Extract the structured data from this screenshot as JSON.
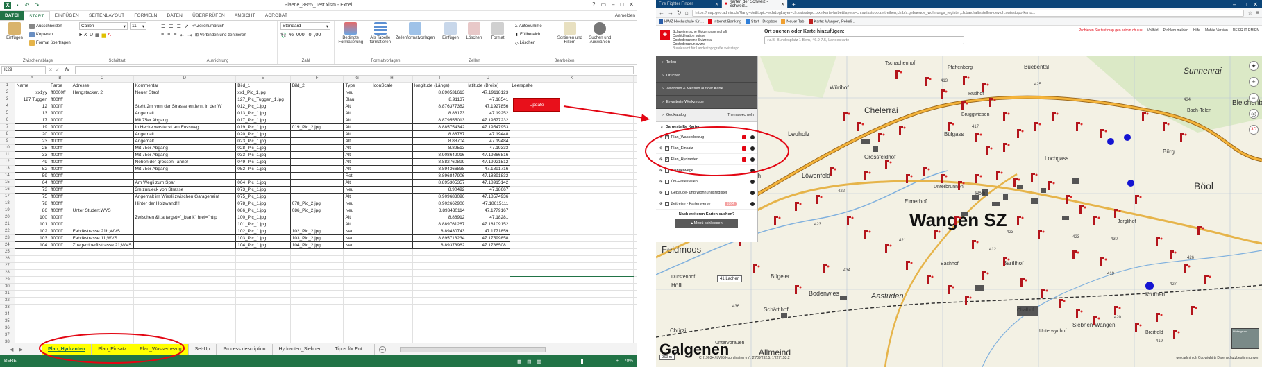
{
  "excel": {
    "title": "Plaene_8855_Test.xlsm - Excel",
    "ribbon_tabs": [
      "DATEI",
      "START",
      "EINFÜGEN",
      "SEITENLAYOUT",
      "FORMELN",
      "DATEN",
      "ÜBERPRÜFEN",
      "ANSICHT",
      "ACROBAT"
    ],
    "signin": "Anmelden",
    "clipboard": {
      "paste": "Einfügen",
      "cut": "Ausschneiden",
      "copy": "Kopieren",
      "format_painter": "Format übertragen",
      "label": "Zwischenablage"
    },
    "font": {
      "name": "Calibri",
      "size": "11",
      "label": "Schriftart"
    },
    "alignment": {
      "wrap": "Zeilenumbruch",
      "merge": "Verbinden und zentrieren",
      "label": "Ausrichtung"
    },
    "number": {
      "format": "Standard",
      "label": "Zahl"
    },
    "styles": {
      "conditional": "Bedingte Formatierung",
      "as_table": "Als Tabelle formatieren",
      "cell_styles": "Zellenformatvorlagen",
      "label": "Formatvorlagen"
    },
    "cells": {
      "insert": "Einfügen",
      "delete": "Löschen",
      "format": "Format",
      "label": "Zellen"
    },
    "editing": {
      "autosum": "AutoSumme",
      "fill": "Füllbereich",
      "clear": "Löschen",
      "sort": "Sortieren und Filtern",
      "find": "Suchen und Auswählen",
      "label": "Bearbeiten"
    },
    "namebox": "K29",
    "columns": [
      "A",
      "B",
      "C",
      "D",
      "E",
      "F",
      "G",
      "H",
      "I",
      "J",
      "K"
    ],
    "headers": [
      "Name",
      "Farbe",
      "Adresse",
      "Kommentar",
      "Bild_1",
      "Bild_2",
      "Type",
      "IconScale",
      "longitude (Länge)",
      "latitude (Breite)",
      "Leerspalte"
    ],
    "rows": [
      [
        "xx1yy",
        "ff0000ff",
        "Hengstacker. 2",
        "Neuer Stao!",
        "xx1_Pic_1.jpg",
        "",
        "Neu",
        "",
        "8.890531613",
        "47.19118123",
        ""
      ],
      [
        "127 Tuggen",
        "ff00ffff",
        "",
        "",
        "127_Pic_Tuggen_1.jpg",
        "",
        "Blau",
        "",
        "8.91137",
        "47.18541",
        ""
      ],
      [
        "12",
        "ff00ffff",
        "",
        "Steht 2m vom der Strasse entfernt in der W",
        "012_Pic_1.jpg",
        "",
        "Alt",
        "",
        "8.876377382",
        "47.1927856",
        ""
      ],
      [
        "13",
        "ff00ffff",
        "",
        "Angemalt",
        "013_Pic_1.jpg",
        "",
        "Alt",
        "",
        "8.88173",
        "47.19252",
        ""
      ],
      [
        "17",
        "ff00ffff",
        "",
        "Mit 75er Abgang",
        "017_Pic_1.jpg",
        "",
        "Alt",
        "",
        "8.879555013",
        "47.19577232",
        ""
      ],
      [
        "19",
        "ff00ffff",
        "",
        "In Hecke versteckt am Fussweg",
        "019_Pic_1.jpg",
        "019_Pic_2.jpg",
        "Alt",
        "",
        "8.885754342",
        "47.19547953",
        ""
      ],
      [
        "20",
        "ff00ffff",
        "",
        "Angemalt",
        "020_Pic_1.jpg",
        "",
        "Alt",
        "",
        "8.88787",
        "47.19448",
        ""
      ],
      [
        "23",
        "ff00ffff",
        "",
        "Angemalt",
        "023_Pic_1.jpg",
        "",
        "Alt",
        "",
        "8.88704",
        "47.19484",
        ""
      ],
      [
        "28",
        "ff00ffff",
        "",
        "Mit 75er Abgang",
        "028_Pic_1.jpg",
        "",
        "Alt",
        "",
        "8.89513",
        "47.19333",
        ""
      ],
      [
        "33",
        "ff00ffff",
        "",
        "Mit 75er Abgang",
        "033_Pic_1.jpg",
        "",
        "Alt",
        "",
        "8.908642016",
        "47.19866816",
        ""
      ],
      [
        "49",
        "ff00ffff",
        "",
        "Neben der grossen Tanne!",
        "049_Pic_1.jpg",
        "",
        "Alt",
        "",
        "8.882760899",
        "47.19921512",
        ""
      ],
      [
        "52",
        "ff00ffff",
        "",
        "Mit 75er Abgang",
        "052_Pic_1.jpg",
        "",
        "Alt",
        "",
        "8.894366838",
        "47.1891716",
        ""
      ],
      [
        "59",
        "ff00ffff",
        "",
        "",
        "",
        "",
        "Rot",
        "",
        "8.896847906",
        "47.18391832",
        ""
      ],
      [
        "64",
        "ff00ffff",
        "",
        "Am Wegli zum Spar",
        "064_Pic_1.jpg",
        "",
        "Alt",
        "",
        "8.895305357",
        "47.18915142",
        ""
      ],
      [
        "73",
        "ff00ffff",
        "",
        "3m zurueck von Strasse",
        "073_Pic_1.jpg",
        "",
        "Neu",
        "",
        "8.90492",
        "47.18667",
        ""
      ],
      [
        "75",
        "ff00ffff",
        "",
        "Angemalt im Wiesli zwischen Garageneinf",
        "075_Pic_1.jpg",
        "",
        "Alt",
        "",
        "8.909683096",
        "47.18574936",
        ""
      ],
      [
        "78",
        "ff00ffff",
        "",
        "Hinter der Holzwand!!!",
        "078_Pic_1.jpg",
        "078_Pic_2.jpg",
        "Neu",
        "",
        "8.902662906",
        "47.18615111",
        ""
      ],
      [
        "86",
        "ff00ffff",
        "Unter Studen;WVS",
        "",
        "086_Pic_1.jpg",
        "086_Pic_2.jpg",
        "Neu",
        "",
        "8.893430114",
        "47.1779167",
        ""
      ],
      [
        "100",
        "ff00ffff",
        "",
        "Zwischen &lt;a target=\"_blank\" href=\"http",
        "100_Pic_1.jpg",
        "",
        "Alt",
        "",
        "8.88912",
        "47.18281",
        ""
      ],
      [
        "101",
        "ff00ffff",
        "",
        "",
        "101_Pic_1.jpg",
        "",
        "Alt",
        "",
        "8.889761267",
        "47.18109152",
        ""
      ],
      [
        "102",
        "ff00ffff",
        "Fabrikstrasse 21h;WVS",
        "",
        "102_Pic_1.jpg",
        "102_Pic_2.jpg",
        "Neu",
        "",
        "8.89430743",
        "47.1771859",
        ""
      ],
      [
        "103",
        "ff00ffff",
        "Fabrikstrasse 11;WVS",
        "",
        "103_Pic_1.jpg",
        "103_Pic_2.jpg",
        "Neu",
        "",
        "8.895713234",
        "47.17599858",
        ""
      ],
      [
        "104",
        "ff00ffff",
        "Zuegerdoerflistrasse 21;WVS",
        "",
        "104_Pic_1.jpg",
        "104_Pic_2.jpg",
        "Neu",
        "",
        "8.89373962",
        "47.17865081",
        ""
      ]
    ],
    "update_button": "Update",
    "sheet_tabs": [
      "Plan_Hydranten",
      "Plan_Einsatz",
      "Plan_Wasserbezug",
      "Set-Up",
      "Process description",
      "Hydranten_Siebnen",
      "Tipps für Ent ..."
    ],
    "status_left": "BEREIT",
    "zoom": "70%"
  },
  "browser": {
    "tabs": [
      "Fire Fighter Finder",
      "Karten der Schweiz - Schweiz..."
    ],
    "url": "https://map.geo.admin.ch/?lang=de&topic=ech&bgLayer=ch.swisstopo.pixelkarte-farbe&layers=ch.swisstopo.zeitreihen,ch.bfs.gebaeude_wohnungs_register,ch.bav.haltestellen-oev,ch.swisstopo-karto...",
    "bookmarks": [
      "HWZ Hochschule für ...",
      "Internet Banking",
      "Start - Dropbox",
      "Neuer Tab",
      "Karte: Wangen, Pekeli..."
    ],
    "orgs": [
      "Schweizerische Eidgenossenschaft",
      "Confédération suisse",
      "Confederazione Svizzera",
      "Confederaziun svizra"
    ],
    "org_sub": "Bundesamt für Landestopografie swisstopo",
    "search_label": "Ort suchen oder Karte hinzufügen:",
    "search_placeholder": "z.B. Bundesplatz 1 Bern, 46.9 7.5, Landeskarte",
    "header_links": [
      "Probieren Sie test.map.geo.admin.ch aus",
      "Vollbild",
      "Problem melden",
      "Hilfe",
      "Mobile Version",
      "DE FR IT RM EN"
    ],
    "menu": [
      "Teilen",
      "Drucken",
      "Zeichnen & Messen auf der Karte",
      "Erweiterte Werkzeuge"
    ],
    "geokatalog": "Geokatalog",
    "thema": "Thema wechseln",
    "dargestellte": "Dargestellte Karten",
    "layers": [
      "Plan_Wasserbezug",
      "Plan_Einsatz",
      "Plan_Hydranten",
      "Wanderwege",
      "ÖV-Haltestellen",
      "Gebäude- und Wohnungsregister",
      "Zeitreise - Kartenwerke"
    ],
    "zeitreise_badge": "1864",
    "more_maps": "Nach weiteren Karten suchen?",
    "close_menu": "Menü schliessen",
    "lachen": "41 Lachen",
    "scale": "300 m",
    "coords": "CH1903+ / LV95   Koordinaten (m): 2'709'292.5, 1'227'153.2",
    "copyright": "geo.admin.ch   Copyright & Datenschutzbestimmungen",
    "minimap": "Hintergrund",
    "place_labels": [
      "Tschachenhof",
      "Pfaffenberg",
      "Buebental",
      "Würihof",
      "Rütihof",
      "Chelerrai",
      "Bruggwiesen",
      "Bülgass",
      "Leuholz",
      "Grossfeldhof",
      "Gätzibach",
      "Löwenfeld",
      "Unterbrunnen",
      "Höfli",
      "Eimerhof",
      "Wangen SZ",
      "Lochgass",
      "Bach-Telen",
      "Bürg",
      "Böol",
      "Jerglihof",
      "Feldmoos",
      "Dürstenhof",
      "Höfli",
      "Bügeler",
      "Bodenwies",
      "Schättihof",
      "Chürzi",
      "Galgenen",
      "Allmeind",
      "Untervorauen",
      "Chalhof",
      "Unterwydhof",
      "Kromen",
      "Siebnen-Wangen",
      "Breitfeld",
      "Bachhof",
      "Bartlihof",
      "Aastuden",
      "Sunnenrai",
      "Bleichenberg"
    ],
    "elevations": [
      "413",
      "425",
      "434",
      "422",
      "423",
      "417",
      "412",
      "423",
      "421",
      "423",
      "430",
      "434",
      "426",
      "419",
      "436",
      "420",
      "419",
      "427"
    ]
  },
  "colors": {
    "excel_green": "#217346",
    "highlight_yellow": "#ffff00",
    "annotation_red": "#e30613",
    "browser_blue": "#0b4478"
  }
}
